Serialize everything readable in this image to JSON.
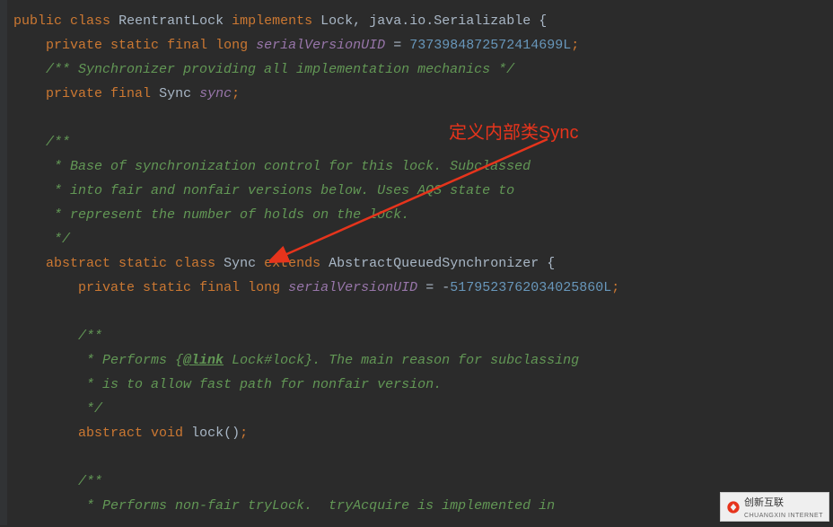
{
  "annotation": {
    "text": "定义内部类Sync"
  },
  "watermark": {
    "brand": "创新互联",
    "sub": "CHUANGXIN INTERNET"
  },
  "code": {
    "line1": {
      "kw1": "public",
      "kw2": "class",
      "name": "ReentrantLock",
      "kw3": "implements",
      "iface1": "Lock",
      "comma": ",",
      "iface2": "java.io.Serializable",
      "brace": "{"
    },
    "line2": {
      "kw1": "private",
      "kw2": "static",
      "kw3": "final",
      "kw4": "long",
      "field": "serialVersionUID",
      "eq": "=",
      "num": "7373984872572414699L",
      "semi": ";"
    },
    "line3": {
      "cmt": "/** Synchronizer providing all implementation mechanics */"
    },
    "line4": {
      "kw1": "private",
      "kw2": "final",
      "type": "Sync",
      "field": "sync",
      "semi": ";"
    },
    "line6": {
      "cmt": "/**"
    },
    "line7": {
      "cmt": " * Base of synchronization control for this lock. Subclassed"
    },
    "line8": {
      "cmt": " * into fair and nonfair versions below. Uses AQS state to"
    },
    "line9": {
      "cmt": " * represent the number of holds on the lock."
    },
    "line10": {
      "cmt": " */"
    },
    "line11": {
      "kw1": "abstract",
      "kw2": "static",
      "kw3": "class",
      "name": "Sync",
      "kw4": "extends",
      "supercls": "AbstractQueuedSynchronizer",
      "brace": "{"
    },
    "line12": {
      "kw1": "private",
      "kw2": "static",
      "kw3": "final",
      "kw4": "long",
      "field": "serialVersionUID",
      "eq": "=",
      "minus": "-",
      "num": "5179523762034025860L",
      "semi": ";"
    },
    "line14": {
      "cmt": "/**"
    },
    "line15": {
      "cmt_a": " * Performs {",
      "tag": "@link",
      "cmt_b": " Lock#lock}. The main reason for subclassing"
    },
    "line16": {
      "cmt": " * is to allow fast path for nonfair version."
    },
    "line17": {
      "cmt": " */"
    },
    "line18": {
      "kw1": "abstract",
      "kw2": "void",
      "method": "lock",
      "parens": "()",
      "semi": ";"
    },
    "line20": {
      "cmt": "/**"
    },
    "line21": {
      "cmt": " * Performs non-fair tryLock.  tryAcquire is implemented in"
    }
  }
}
